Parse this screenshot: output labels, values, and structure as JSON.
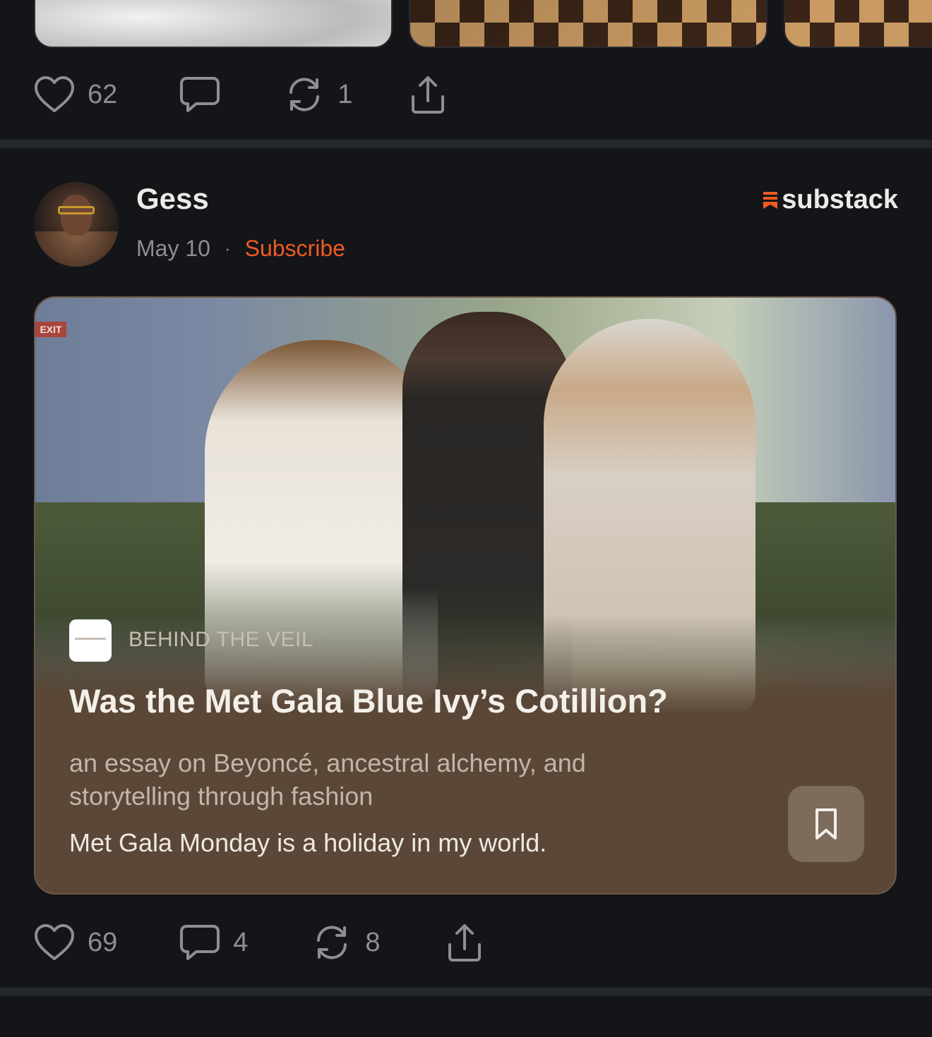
{
  "prev_post": {
    "actions": {
      "like_count": "62",
      "comment_count": "",
      "restack_count": "1"
    }
  },
  "post": {
    "author_name": "Gess",
    "date": "May 10",
    "separator": "·",
    "subscribe_label": "Subscribe",
    "brand": "substack",
    "card": {
      "publication": "BEHIND THE VEIL",
      "title": "Was the Met Gala Blue Ivy’s Cotillion?",
      "subtitle": "an essay on Beyoncé, ancestral alchemy, and storytelling through fashion",
      "snippet": "Met Gala Monday is a holiday in my world."
    },
    "actions": {
      "like_count": "69",
      "comment_count": "4",
      "restack_count": "8"
    }
  },
  "colors": {
    "background": "#141518",
    "accent": "#ef5a24",
    "card": "#5a4737",
    "muted_text": "#8e8f92"
  },
  "icons": [
    "heart-icon",
    "comment-icon",
    "restack-icon",
    "share-icon",
    "bookmark-icon",
    "substack-logo-icon"
  ]
}
